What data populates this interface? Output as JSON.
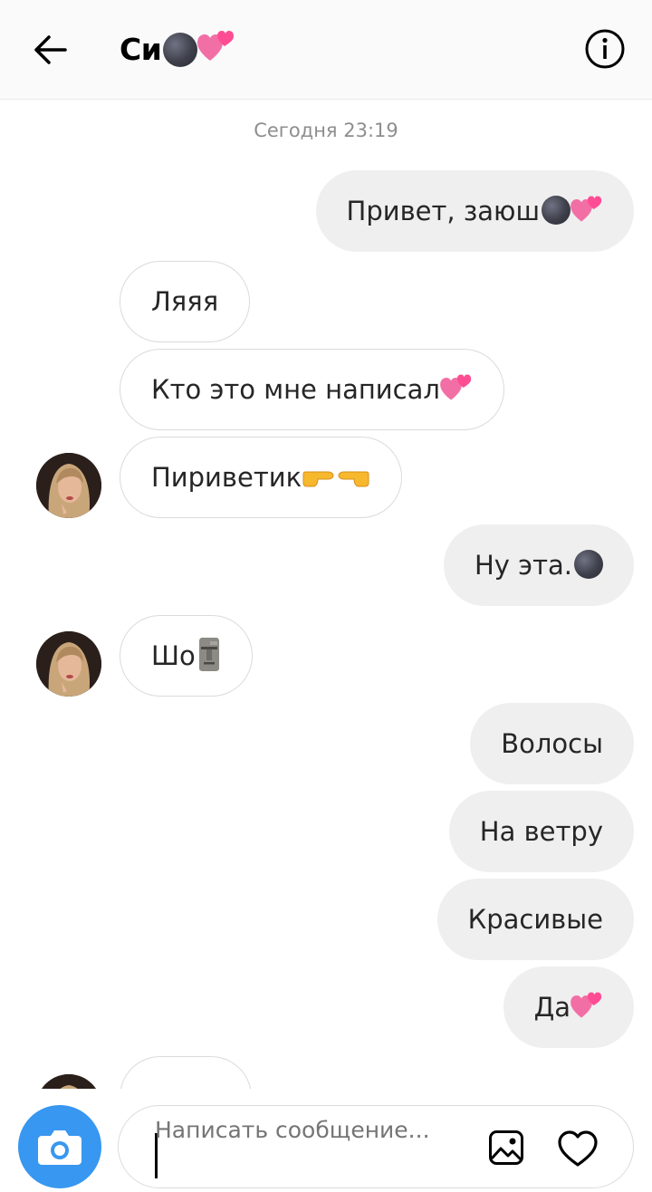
{
  "header": {
    "back_icon": "arrow-left-icon",
    "contact_name": "Си",
    "info_icon": "info-circle-icon"
  },
  "thread": {
    "timestamp": "Сегодня 23:19",
    "messages": [
      {
        "side": "out",
        "text": "Привет, заюш",
        "emoji": [
          "new-moon-face",
          "two-hearts"
        ]
      },
      {
        "side": "in",
        "text": "Ляяя",
        "emoji": []
      },
      {
        "side": "in",
        "text": "Кто это мне написал",
        "emoji": [
          "two-hearts"
        ]
      },
      {
        "side": "in",
        "text": "Пириветик",
        "emoji": [
          "pointing-right",
          "pointing-left"
        ],
        "avatar": true
      },
      {
        "side": "out",
        "text": "Ну эта.",
        "emoji": [
          "new-moon-face"
        ]
      },
      {
        "side": "in",
        "text": "Шо",
        "emoji": [
          "moai"
        ],
        "avatar": true
      },
      {
        "side": "out",
        "text": "Волосы",
        "emoji": []
      },
      {
        "side": "out",
        "text": "На ветру",
        "emoji": []
      },
      {
        "side": "out",
        "text": "Красивые",
        "emoji": []
      },
      {
        "side": "out",
        "text": "Да",
        "emoji": [
          "two-hearts"
        ]
      }
    ]
  },
  "composer": {
    "camera_icon": "camera-icon",
    "placeholder": "Написать сообщение...",
    "gallery_icon": "image-icon",
    "like_icon": "heart-icon"
  },
  "colors": {
    "outgoing_bubble": "#efefef",
    "incoming_border": "#dbdbdb",
    "camera_blue": "#3897f0",
    "timestamp_gray": "#8e8e8e"
  }
}
